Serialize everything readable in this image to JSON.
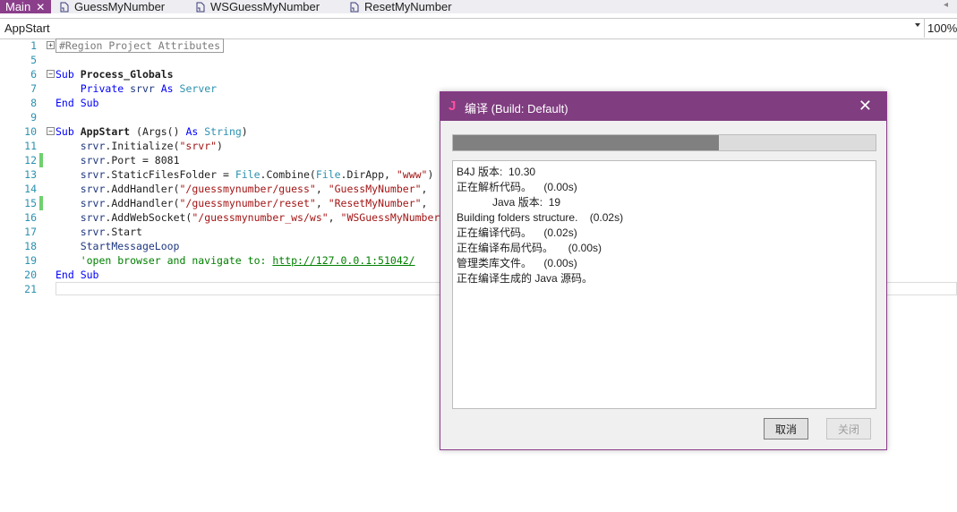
{
  "tabs": [
    {
      "label": "Main",
      "active": true,
      "close_glyph": "✕"
    },
    {
      "label": "GuessMyNumber",
      "icon": "document-icon"
    },
    {
      "label": "WSGuessMyNumber",
      "icon": "document-icon"
    },
    {
      "label": "ResetMyNumber",
      "icon": "document-icon"
    }
  ],
  "combo": {
    "value": "AppStart",
    "zoom": "100%"
  },
  "editor": {
    "line_numbers": [
      "1",
      "5",
      "6",
      "7",
      "8",
      "9",
      "10",
      "11",
      "12",
      "13",
      "14",
      "15",
      "16",
      "17",
      "18",
      "19",
      "20",
      "21"
    ],
    "region_text": "#Region Project Attributes",
    "sub1": {
      "kw_sub": "Sub",
      "name": "Process_Globals",
      "kw_private": "Private",
      "var": "srvr",
      "kw_as": "As",
      "type": "Server",
      "kw_end": "End Sub"
    },
    "sub2": {
      "kw_sub": "Sub",
      "name": "AppStart",
      "args": "(Args()",
      "kw_as": "As",
      "type": "String",
      "close": ")",
      "l11": {
        "var": "srvr",
        "call": ".Initialize(",
        "str": "\"srvr\"",
        "end": ")"
      },
      "l12": {
        "var": "srvr",
        "rest": ".Port = 8081"
      },
      "l13": {
        "var": "srvr",
        "a": ".StaticFilesFolder = ",
        "file1": "File",
        "b": ".Combine(",
        "file2": "File",
        "c": ".DirApp, ",
        "str": "\"www\"",
        "d": ")"
      },
      "l14": {
        "var": "srvr",
        "a": ".AddHandler(",
        "s1": "\"/guessmynumber/guess\"",
        "b": ", ",
        "s2": "\"GuessMyNumber\"",
        "c": ", "
      },
      "l15": {
        "var": "srvr",
        "a": ".AddHandler(",
        "s1": "\"/guessmynumber/reset\"",
        "b": ", ",
        "s2": "\"ResetMyNumber\"",
        "c": ", "
      },
      "l16": {
        "var": "srvr",
        "a": ".AddWebSocket(",
        "s1": "\"/guessmynumber_ws/ws\"",
        "b": ", ",
        "s2": "\"WSGuessMyNumber"
      },
      "l17": {
        "var": "srvr",
        "rest": ".Start"
      },
      "l18": {
        "call": "StartMessageLoop"
      },
      "l19": {
        "comment": "'open browser and navigate to: ",
        "link": "http://127.0.0.1:51042/"
      },
      "kw_end": "End Sub"
    }
  },
  "dialog": {
    "icon_letter": "J",
    "title": "编译 (Build: Default)",
    "close_glyph": "✕",
    "progress": 0.63,
    "log": [
      "B4J 版本:  10.30",
      "正在解析代码。    (0.00s)",
      "            Java 版本:  19",
      "Building folders structure.    (0.02s)",
      "正在编译代码。    (0.02s)",
      "正在编译布局代码。     (0.00s)",
      "管理类库文件。    (0.00s)",
      "正在编译生成的 Java 源码。"
    ],
    "cancel_label": "取消",
    "close_label": "关闭"
  },
  "colors": {
    "accent": "#803d80",
    "tab_active": "#8b3f8b",
    "change_marker": "#6fd06f"
  }
}
